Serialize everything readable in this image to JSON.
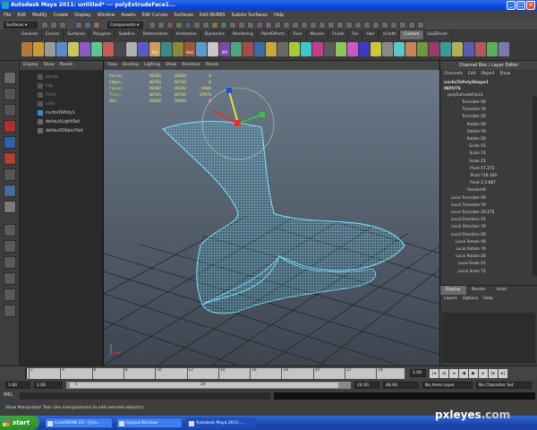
{
  "window": {
    "title": "Autodesk Maya 2011: untitled*   ---   polyExtrudeFace1..."
  },
  "menu": [
    "File",
    "Edit",
    "Modify",
    "Create",
    "Display",
    "Window",
    "Assets",
    "Edit Curves",
    "Surfaces",
    "Edit NURBS",
    "Subdiv Surfaces",
    "Help"
  ],
  "status_line": {
    "menu_set": "Surfaces",
    "selection_mode": "Components"
  },
  "shelf_tabs": [
    "General",
    "Curves",
    "Surfaces",
    "Polygons",
    "Subdivs",
    "Deformation",
    "Animation",
    "Dynamics",
    "Rendering",
    "PaintEffects",
    "Toon",
    "Muscle",
    "Fluids",
    "Fur",
    "Hair",
    "nCloth",
    "Custom",
    "GoZBrush"
  ],
  "shelf_active": "Custom",
  "shelf_labels": [
    "Ral",
    "Hist",
    "IPR"
  ],
  "outliner": {
    "menu": [
      "Display",
      "Show",
      "Panels"
    ],
    "items": [
      {
        "label": "persp",
        "dim": true
      },
      {
        "label": "top",
        "dim": true
      },
      {
        "label": "front",
        "dim": true
      },
      {
        "label": "side",
        "dim": true
      },
      {
        "label": "nurbsToPoly1",
        "dim": false
      },
      {
        "label": "defaultLightSet",
        "dim": false
      },
      {
        "label": "defaultObjectSet",
        "dim": false
      }
    ]
  },
  "viewport": {
    "menu": [
      "View",
      "Shading",
      "Lighting",
      "Show",
      "Renderer",
      "Panels"
    ],
    "hud": [
      {
        "label": "Verts:",
        "a": "28384",
        "b": "28384",
        "c": "0"
      },
      {
        "label": "Edges:",
        "a": "40764",
        "b": "40764",
        "c": "0"
      },
      {
        "label": "Faces:",
        "a": "20382",
        "b": "20382",
        "c": "9966"
      },
      {
        "label": "Tris:",
        "a": "40764",
        "b": "40764",
        "c": "19970"
      },
      {
        "label": "UVs:",
        "a": "29056",
        "b": "29056",
        "c": "0"
      }
    ],
    "colors": {
      "mesh": "#5fd4f0",
      "grid": "#1a1a1a",
      "bg_top": "#6c7a8a",
      "bg_bottom": "#3e4550"
    }
  },
  "channel_box": {
    "title": "Channel Box / Layer Editor",
    "menu": [
      "Channels",
      "Edit",
      "Object",
      "Show"
    ],
    "shape": "nurbsToPolyShape1",
    "inputs_label": "INPUTS",
    "node": "polyExtrudeFace1",
    "attrs": [
      {
        "name": "Translate X",
        "value": "0"
      },
      {
        "name": "Translate Y",
        "value": "0"
      },
      {
        "name": "Translate Z",
        "value": "0"
      },
      {
        "name": "Rotate X",
        "value": "0"
      },
      {
        "name": "Rotate Y",
        "value": "0"
      },
      {
        "name": "Rotate Z",
        "value": "0"
      },
      {
        "name": "Scale X",
        "value": "1"
      },
      {
        "name": "Scale Y",
        "value": "1"
      },
      {
        "name": "Scale Z",
        "value": "1"
      },
      {
        "name": "Pivot X",
        "value": "7.273"
      },
      {
        "name": "Pivot Y",
        "value": "16.103"
      },
      {
        "name": "Pivot Z",
        "value": "-2.667"
      },
      {
        "name": "Random",
        "value": "0"
      },
      {
        "name": "Local Translate X",
        "value": "0"
      },
      {
        "name": "Local Translate Y",
        "value": "0"
      },
      {
        "name": "Local Translate Z",
        "value": "0.275"
      },
      {
        "name": "Local Direction X",
        "value": "1"
      },
      {
        "name": "Local Direction Y",
        "value": "0"
      },
      {
        "name": "Local Direction Z",
        "value": "0"
      },
      {
        "name": "Local Rotate X",
        "value": "0"
      },
      {
        "name": "Local Rotate Y",
        "value": "0"
      },
      {
        "name": "Local Rotate Z",
        "value": "0"
      },
      {
        "name": "Local Scale X",
        "value": "1"
      },
      {
        "name": "Local Scale Y",
        "value": "1"
      }
    ]
  },
  "layer_editor": {
    "tabs": [
      "Display",
      "Render",
      "Anim"
    ],
    "active_tab": "Display",
    "menu": [
      "Layers",
      "Options",
      "Help"
    ]
  },
  "time_slider": {
    "ticks": [
      "2",
      "4",
      "6",
      "8",
      "10",
      "12",
      "14",
      "16",
      "18",
      "20",
      "22",
      "24"
    ],
    "current_frame": "1.00"
  },
  "range_slider": {
    "start": "1.00",
    "playback_start": "1.00",
    "marker_start": "1",
    "marker_end": "24",
    "playback_end": "24.00",
    "end": "48.00",
    "anim_layer": "No Anim Layer",
    "char_set": "No Character Set"
  },
  "command_line": {
    "label": "MEL"
  },
  "help_line": "Show Manipulator Tool: Use manipulator(s) to edit selected object(s).",
  "taskbar": {
    "start": "start",
    "items": [
      {
        "label": "CorelDRAW X3 - [Gra...",
        "active": false
      },
      {
        "label": "Output Window",
        "active": false
      },
      {
        "label": "Autodesk Maya 2011:...",
        "active": true
      }
    ]
  },
  "watermark": {
    "text": "pxleyes",
    "suffix": ".com"
  }
}
